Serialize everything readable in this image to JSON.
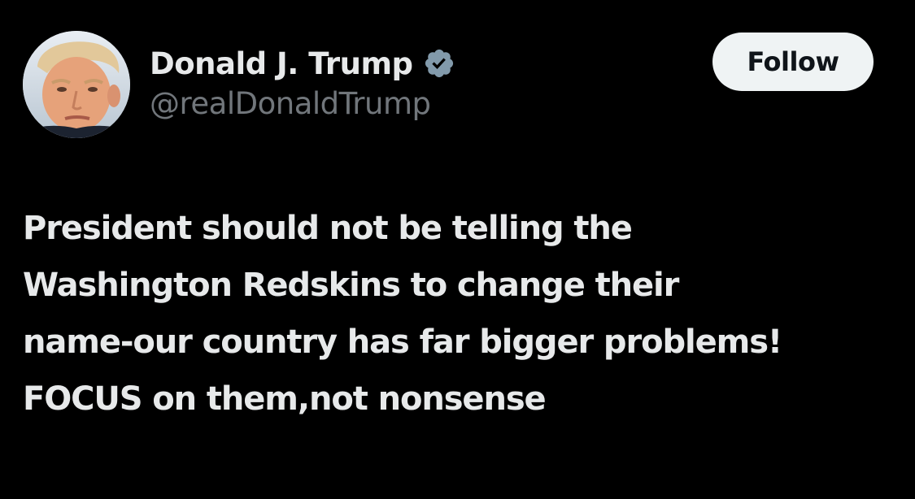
{
  "author": {
    "display_name": "Donald J. Trump",
    "handle": "@realDonaldTrump",
    "avatar_icon": "profile-photo",
    "verified_icon": "verified-badge-icon"
  },
  "actions": {
    "follow_label": "Follow"
  },
  "tweet": {
    "text_lines": [
      "President should not be telling the",
      "Washington Redskins to change their",
      "name-our country has far bigger problems!",
      "FOCUS on them,not nonsense"
    ]
  },
  "colors": {
    "background": "#000000",
    "primary_text": "#e7e9ea",
    "secondary_text": "#71767b",
    "follow_button_bg": "#eff3f4",
    "follow_button_text": "#0f1419",
    "verified_badge": "#829aab"
  }
}
